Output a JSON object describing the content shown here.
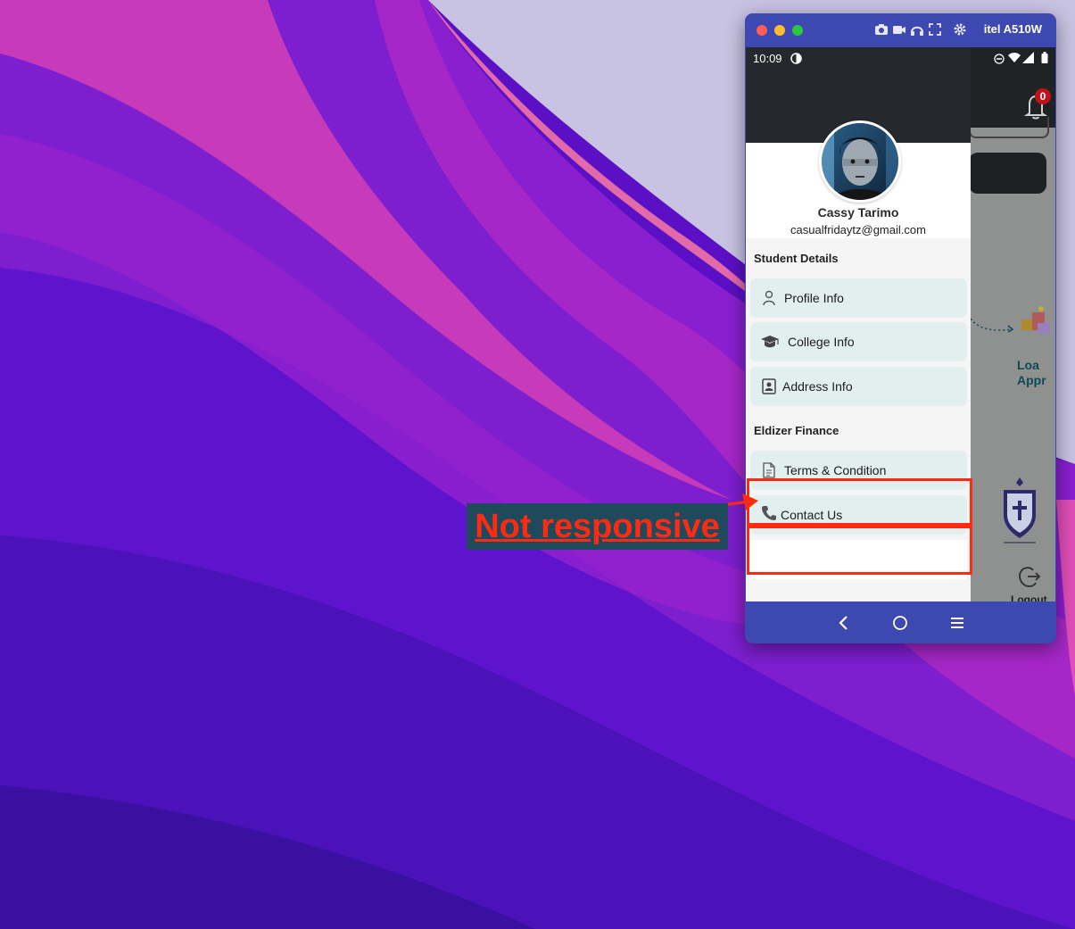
{
  "emulator": {
    "device_name": "itel A510W",
    "toolbar_icons": [
      "camera-icon",
      "video-icon",
      "headphones-icon",
      "fullscreen-icon",
      "settings-icon"
    ]
  },
  "status_bar": {
    "time": "10:09"
  },
  "background_app": {
    "notification_count": "0",
    "loan_text_line1": "Loa",
    "loan_text_line2": "Appr",
    "logout_label": "Logout"
  },
  "drawer": {
    "user_name": "Cassy Tarimo",
    "user_email": "casualfridaytz@gmail.com",
    "sections": [
      {
        "title": "Student Details",
        "items": [
          {
            "label": "Profile Info",
            "icon": "person-icon"
          },
          {
            "label": "College Info",
            "icon": "graduation-cap-icon"
          },
          {
            "label": "Address Info",
            "icon": "contact-card-icon"
          }
        ]
      },
      {
        "title": "Eldizer Finance",
        "items": [
          {
            "label": "Terms & Condition",
            "icon": "document-icon"
          },
          {
            "label": "Contact Us",
            "icon": "phone-icon"
          }
        ]
      }
    ]
  },
  "annotation": {
    "label": "Not responsive",
    "color": "#ff2a12"
  },
  "colors": {
    "window_chrome": "#3d48b0",
    "menu_item_bg": "#e2efef",
    "drawer_header": "#25292d"
  }
}
